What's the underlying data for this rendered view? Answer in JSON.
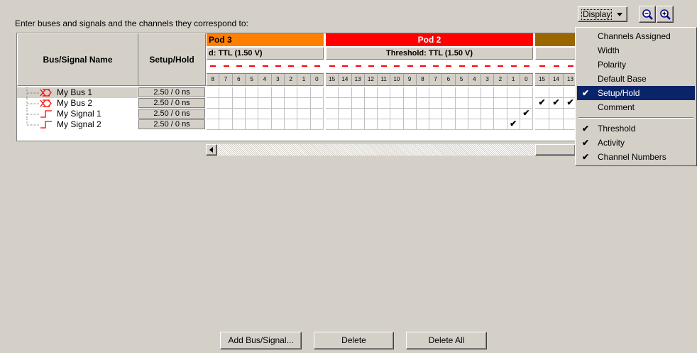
{
  "instructions": "Enter buses and signals and the channels they correspond to:",
  "toolbar": {
    "display_label": "Display"
  },
  "table": {
    "col_name_header": "Bus/Signal Name",
    "col_setup_header": "Setup/Hold",
    "pods": [
      {
        "label": "Pod 3",
        "threshold": "d: TTL (1.50 V)",
        "color": "#ff8000",
        "channels": [
          "8",
          "7",
          "6",
          "5",
          "4",
          "3",
          "2",
          "1",
          "0"
        ]
      },
      {
        "label": "Pod 2",
        "threshold": "Threshold: TTL (1.50 V)",
        "color": "#ff0000",
        "channels": [
          "15",
          "14",
          "13",
          "12",
          "11",
          "10",
          "9",
          "8",
          "7",
          "6",
          "5",
          "4",
          "3",
          "2",
          "1",
          "0"
        ]
      },
      {
        "label": "",
        "threshold": "",
        "color": "#996600",
        "channels": [
          "15",
          "14",
          "13"
        ]
      }
    ],
    "rows": [
      {
        "name": "My Bus 1",
        "setup": "2.50 / 0 ns",
        "kind": "bus"
      },
      {
        "name": "My Bus 2",
        "setup": "2.50 / 0 ns",
        "kind": "bus"
      },
      {
        "name": "My Signal 1",
        "setup": "2.50 / 0 ns",
        "kind": "signal"
      },
      {
        "name": "My Signal 2",
        "setup": "2.50 / 0 ns",
        "kind": "signal"
      }
    ],
    "checks": {
      "check_glyph": "✔"
    }
  },
  "menu": {
    "check_glyph": "✔",
    "items": [
      {
        "label": "Channels Assigned",
        "checked": false
      },
      {
        "label": "Width",
        "checked": false
      },
      {
        "label": "Polarity",
        "checked": false
      },
      {
        "label": "Default Base",
        "checked": false
      },
      {
        "label": "Setup/Hold",
        "checked": true,
        "selected": true
      },
      {
        "label": "Comment",
        "checked": false
      },
      {
        "label": "Threshold",
        "checked": true
      },
      {
        "label": "Activity",
        "checked": true
      },
      {
        "label": "Channel Numbers",
        "checked": true
      }
    ]
  },
  "buttons": {
    "add": "Add Bus/Signal...",
    "delete": "Delete",
    "delete_all": "Delete All"
  },
  "colors": {
    "accent_selection": "#0a246a",
    "bus_icon": "#ff0000"
  }
}
